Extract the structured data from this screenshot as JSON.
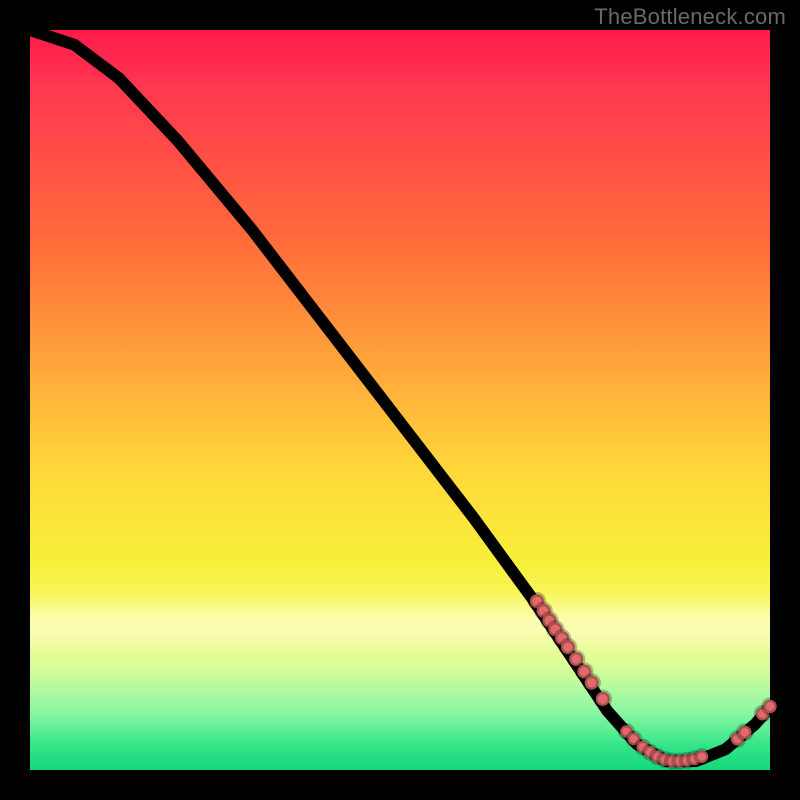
{
  "watermark": "TheBottleneck.com",
  "chart_data": {
    "type": "line",
    "title": "",
    "xlabel": "",
    "ylabel": "",
    "xlim": [
      0,
      100
    ],
    "ylim": [
      0,
      100
    ],
    "grid": false,
    "legend": false,
    "curve": [
      {
        "x": 0,
        "y": 100
      },
      {
        "x": 6,
        "y": 98
      },
      {
        "x": 12,
        "y": 93.5
      },
      {
        "x": 20,
        "y": 85
      },
      {
        "x": 30,
        "y": 73
      },
      {
        "x": 40,
        "y": 60
      },
      {
        "x": 50,
        "y": 47
      },
      {
        "x": 60,
        "y": 34
      },
      {
        "x": 68,
        "y": 23
      },
      {
        "x": 74,
        "y": 14
      },
      {
        "x": 78,
        "y": 8
      },
      {
        "x": 82,
        "y": 3.5
      },
      {
        "x": 86,
        "y": 1.2
      },
      {
        "x": 90,
        "y": 1.2
      },
      {
        "x": 94,
        "y": 2.8
      },
      {
        "x": 98,
        "y": 6.2
      },
      {
        "x": 100,
        "y": 8.5
      }
    ],
    "points_cluster_a": [
      {
        "x": 68.5,
        "y": 22.8
      },
      {
        "x": 69.4,
        "y": 21.5
      },
      {
        "x": 70.2,
        "y": 20.2
      },
      {
        "x": 71.0,
        "y": 19.0
      },
      {
        "x": 71.9,
        "y": 17.8
      },
      {
        "x": 72.7,
        "y": 16.6
      },
      {
        "x": 73.8,
        "y": 15.0
      },
      {
        "x": 74.9,
        "y": 13.3
      },
      {
        "x": 75.9,
        "y": 11.8
      },
      {
        "x": 77.4,
        "y": 9.6
      }
    ],
    "points_cluster_b": [
      {
        "x": 80.6,
        "y": 5.2
      },
      {
        "x": 81.6,
        "y": 4.2
      },
      {
        "x": 82.8,
        "y": 3.1
      },
      {
        "x": 83.8,
        "y": 2.4
      },
      {
        "x": 84.8,
        "y": 1.8
      },
      {
        "x": 85.8,
        "y": 1.4
      },
      {
        "x": 86.8,
        "y": 1.2
      },
      {
        "x": 87.8,
        "y": 1.2
      },
      {
        "x": 88.8,
        "y": 1.3
      },
      {
        "x": 89.8,
        "y": 1.5
      },
      {
        "x": 90.8,
        "y": 1.8
      }
    ],
    "points_cluster_c": [
      {
        "x": 95.6,
        "y": 4.2
      },
      {
        "x": 96.6,
        "y": 5.1
      },
      {
        "x": 99.0,
        "y": 7.6
      },
      {
        "x": 100.0,
        "y": 8.6
      }
    ]
  }
}
